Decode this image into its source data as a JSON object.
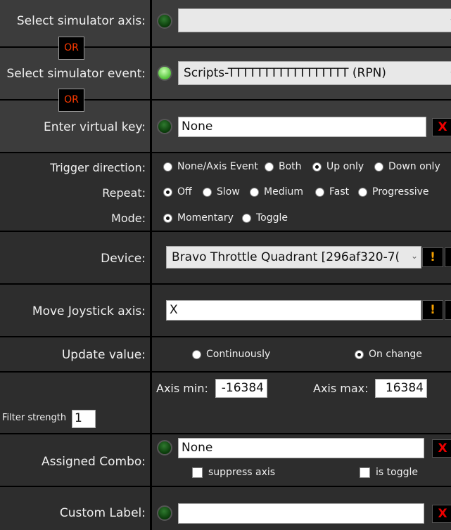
{
  "axis": {
    "label": "Select simulator axis:",
    "value": ""
  },
  "or_label": "OR",
  "event": {
    "label": "Select simulator event:",
    "value": "Scripts-TTTTTTTTTTTTTTTTT (RPN)"
  },
  "vkey": {
    "label": "Enter virtual key:",
    "value": "None",
    "clear": "X"
  },
  "trigger": {
    "label": "Trigger direction:",
    "options": [
      "None/Axis Event",
      "Both",
      "Up only",
      "Down only"
    ],
    "selected": "Up only"
  },
  "repeat": {
    "label": "Repeat:",
    "options": [
      "Off",
      "Slow",
      "Medium",
      "Fast",
      "Progressive"
    ],
    "selected": "Off"
  },
  "mode": {
    "label": "Mode:",
    "options": [
      "Momentary",
      "Toggle"
    ],
    "selected": "Momentary"
  },
  "device": {
    "label": "Device:",
    "value": "Bravo Throttle Quadrant [296af320-7(",
    "warn": "!"
  },
  "joystick": {
    "label": "Move Joystick axis:",
    "value": "X",
    "warn": "!"
  },
  "update": {
    "label": "Update value:",
    "options": [
      "Continuously",
      "On change"
    ],
    "selected": "On change"
  },
  "axisrange": {
    "min_label": "Axis min:",
    "min": "-16384",
    "max_label": "Axis max:",
    "max": "16384",
    "filter_label": "Filter strength",
    "filter": "1"
  },
  "combo": {
    "label": "Assigned Combo:",
    "value": "None",
    "clear": "X",
    "suppress": "suppress axis",
    "toggle": "is toggle"
  },
  "custom": {
    "label": "Custom Label:",
    "value": "",
    "clear": "X"
  }
}
